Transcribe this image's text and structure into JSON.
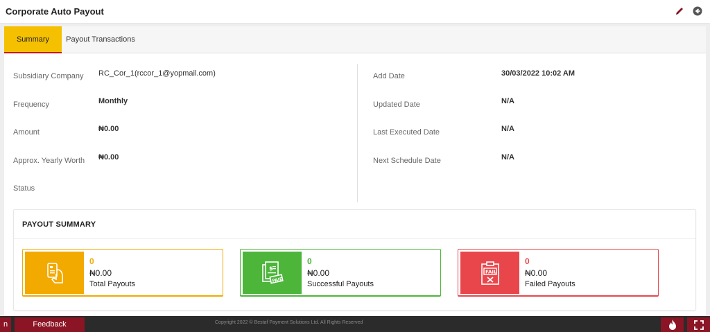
{
  "header": {
    "title": "Corporate Auto Payout",
    "icons": [
      "pencil-icon",
      "back-arrow-icon"
    ]
  },
  "tabs": [
    {
      "label": "Summary",
      "active": true
    },
    {
      "label": "Payout Transactions",
      "active": false
    }
  ],
  "details": {
    "left": [
      {
        "label": "Subsidiary Company",
        "value": "RC_Cor_1(rccor_1@yopmail.com)"
      },
      {
        "label": "Frequency",
        "value": "Monthly"
      },
      {
        "label": "Amount",
        "value": "₦0.00"
      },
      {
        "label": "Approx. Yearly Worth",
        "value": "₦0.00"
      },
      {
        "label": "Status",
        "value": ""
      }
    ],
    "right": [
      {
        "label": "Add Date",
        "value": "30/03/2022 10:02 AM"
      },
      {
        "label": "Updated Date",
        "value": "N/A"
      },
      {
        "label": "Last Executed Date",
        "value": "N/A"
      },
      {
        "label": "Next Schedule Date",
        "value": "N/A"
      }
    ]
  },
  "payout_summary": {
    "title": "PAYOUT SUMMARY",
    "cards": [
      {
        "count": "0",
        "amount": "₦0.00",
        "label": "Total Payouts",
        "color": "#f2a900",
        "icon": "card-in-hand-icon"
      },
      {
        "count": "0",
        "amount": "₦0.00",
        "label": "Successful Payouts",
        "color": "#4cb53a",
        "icon": "paid-receipt-icon"
      },
      {
        "count": "0",
        "amount": "₦0.00",
        "label": "Failed Payouts",
        "color": "#e8464b",
        "icon": "fail-clipboard-icon"
      }
    ]
  },
  "footer": {
    "left_button": "n",
    "feedback": "Feedback",
    "copyright": "Copyright 2022 © Bestaf Payment Solutions Ltd. All Rights Reserved",
    "icons": [
      "fire-icon",
      "fullscreen-icon"
    ],
    "accent": "#8b1524"
  }
}
